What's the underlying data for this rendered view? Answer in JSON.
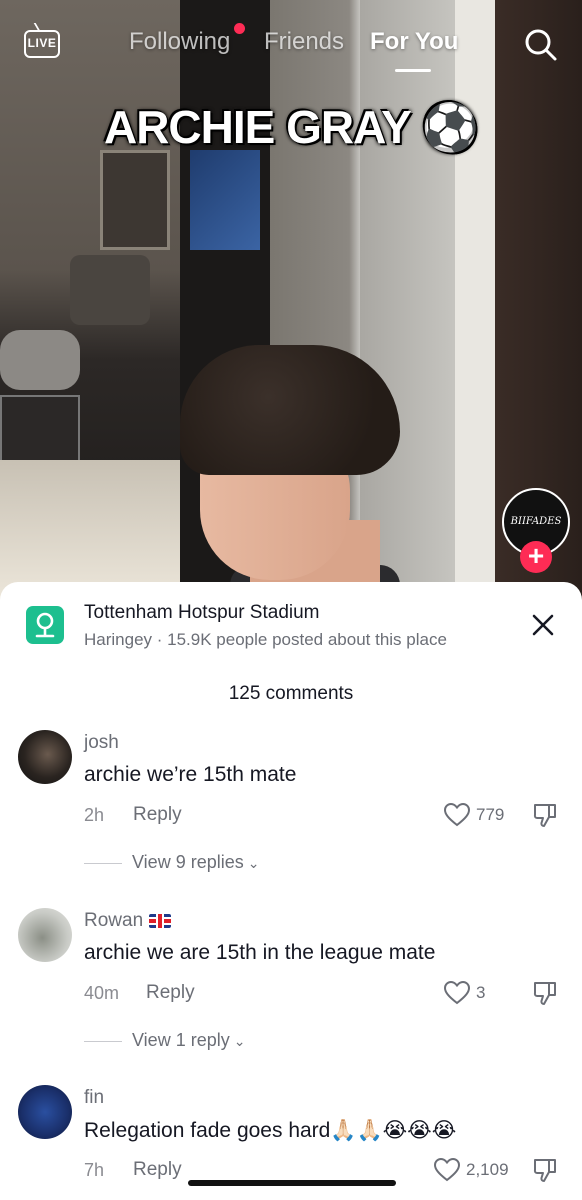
{
  "topnav": {
    "live_label": "LIVE",
    "tabs": [
      "Following",
      "Friends",
      "For You"
    ],
    "active_tab": "For You"
  },
  "video": {
    "title": "ARCHIE GRAY ⚽",
    "creator_avatar_text": "BIIFADES"
  },
  "place": {
    "name": "Tottenham Hotspur Stadium",
    "subtitle": "Haringey · 15.9K people posted about this place"
  },
  "comments_header": "125 comments",
  "comments": [
    {
      "user": "josh",
      "text": "archie we’re 15th mate",
      "time": "2h",
      "reply_label": "Reply",
      "likes": "779",
      "view_replies": "View 9 replies"
    },
    {
      "user": "Rowan",
      "text": "archie we are 15th in the league mate",
      "time": "40m",
      "reply_label": "Reply",
      "likes": "3",
      "view_replies": "View 1 reply"
    },
    {
      "user": "fin",
      "text": "Relegation fade goes hard🙏🏻🙏🏻😭😭😭",
      "time": "7h",
      "reply_label": "Reply",
      "likes": "2,109"
    }
  ],
  "colors": {
    "accent": "#fe2c55",
    "place_icon": "#1dbf8f",
    "text_primary": "#161823",
    "text_secondary": "#6b6e76"
  }
}
